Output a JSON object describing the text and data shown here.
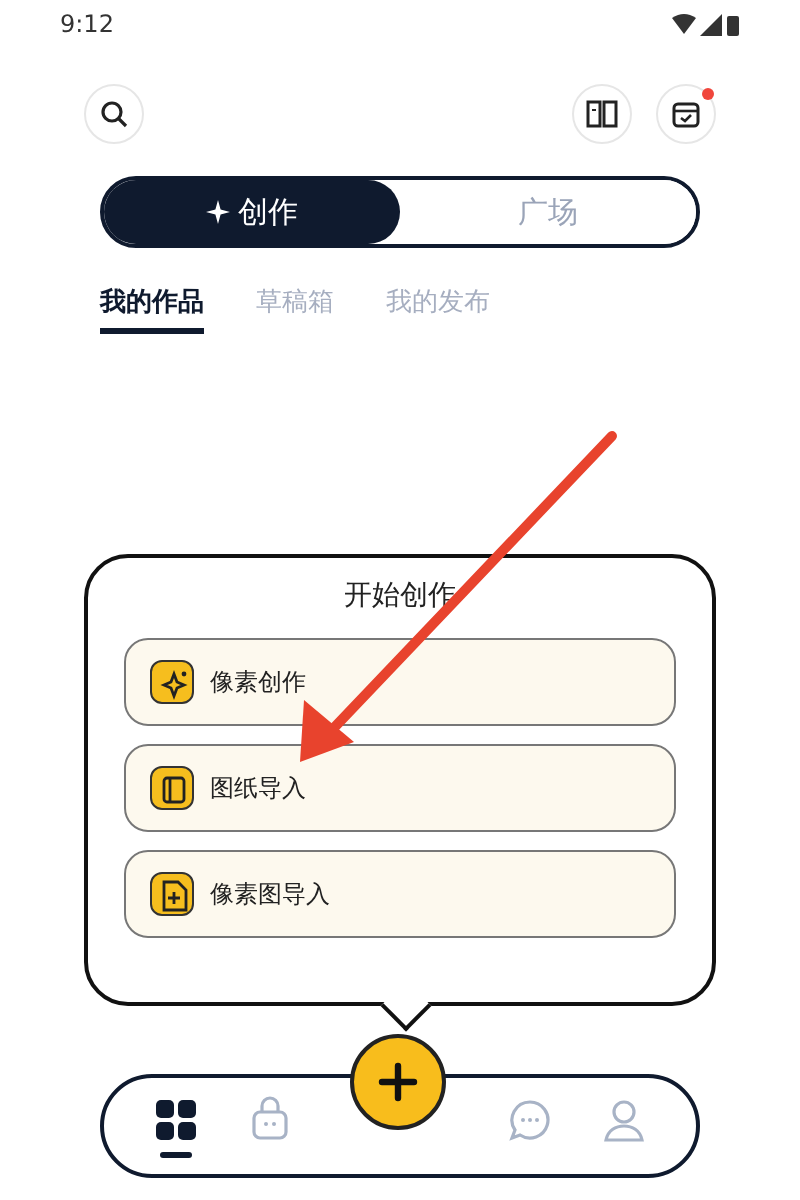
{
  "status_bar": {
    "time": "9:12"
  },
  "header": {
    "calendar_badge": true
  },
  "mode_switch": [
    {
      "label": "创作",
      "selected": true
    },
    {
      "label": "广场",
      "selected": false
    }
  ],
  "tabs": [
    {
      "label": "我的作品",
      "selected": true
    },
    {
      "label": "草稿箱",
      "selected": false
    },
    {
      "label": "我的发布",
      "selected": false
    }
  ],
  "popup": {
    "title": "开始创作",
    "options": [
      {
        "label": "像素创作",
        "kind": "pixel"
      },
      {
        "label": "图纸导入",
        "kind": "blueprint"
      },
      {
        "label": "像素图导入",
        "kind": "image"
      }
    ]
  },
  "bottom_nav": [
    {
      "kind": "grid",
      "selected": true
    },
    {
      "kind": "bot",
      "selected": false
    },
    {
      "kind": "chat",
      "selected": false
    },
    {
      "kind": "user",
      "selected": false
    }
  ]
}
